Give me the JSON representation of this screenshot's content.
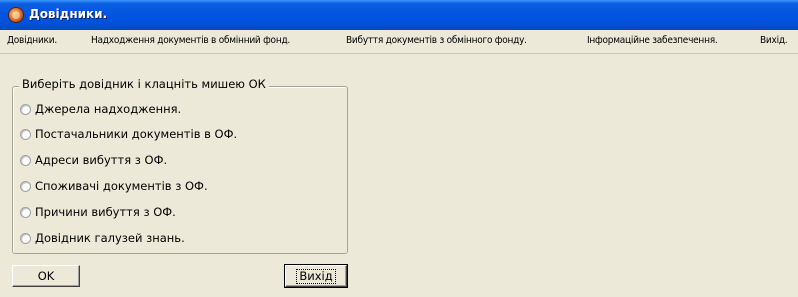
{
  "window": {
    "title": "Довідники."
  },
  "menu": {
    "items": [
      "Довідники.",
      "Надходження документів в обмінний фонд.",
      "Вибуття документів з обмінного фонду.",
      "Інформаційне забезпечення.",
      "Вихід."
    ]
  },
  "group": {
    "legend": "Виберіть довідник і клацніть мишею ОК",
    "options": [
      "Джерела надходження.",
      "Постачальники документів в ОФ.",
      "Адреси вибуття з ОФ.",
      "Споживачі документів з ОФ.",
      "Причини вибуття з ОФ.",
      "Довідник галузей знань."
    ]
  },
  "buttons": {
    "ok_label": "OK",
    "exit_label": "Вихід"
  },
  "icons": {
    "app": "app-icon"
  },
  "colors": {
    "titlebar": "#0054e3",
    "window_bg": "#ece9d8"
  }
}
